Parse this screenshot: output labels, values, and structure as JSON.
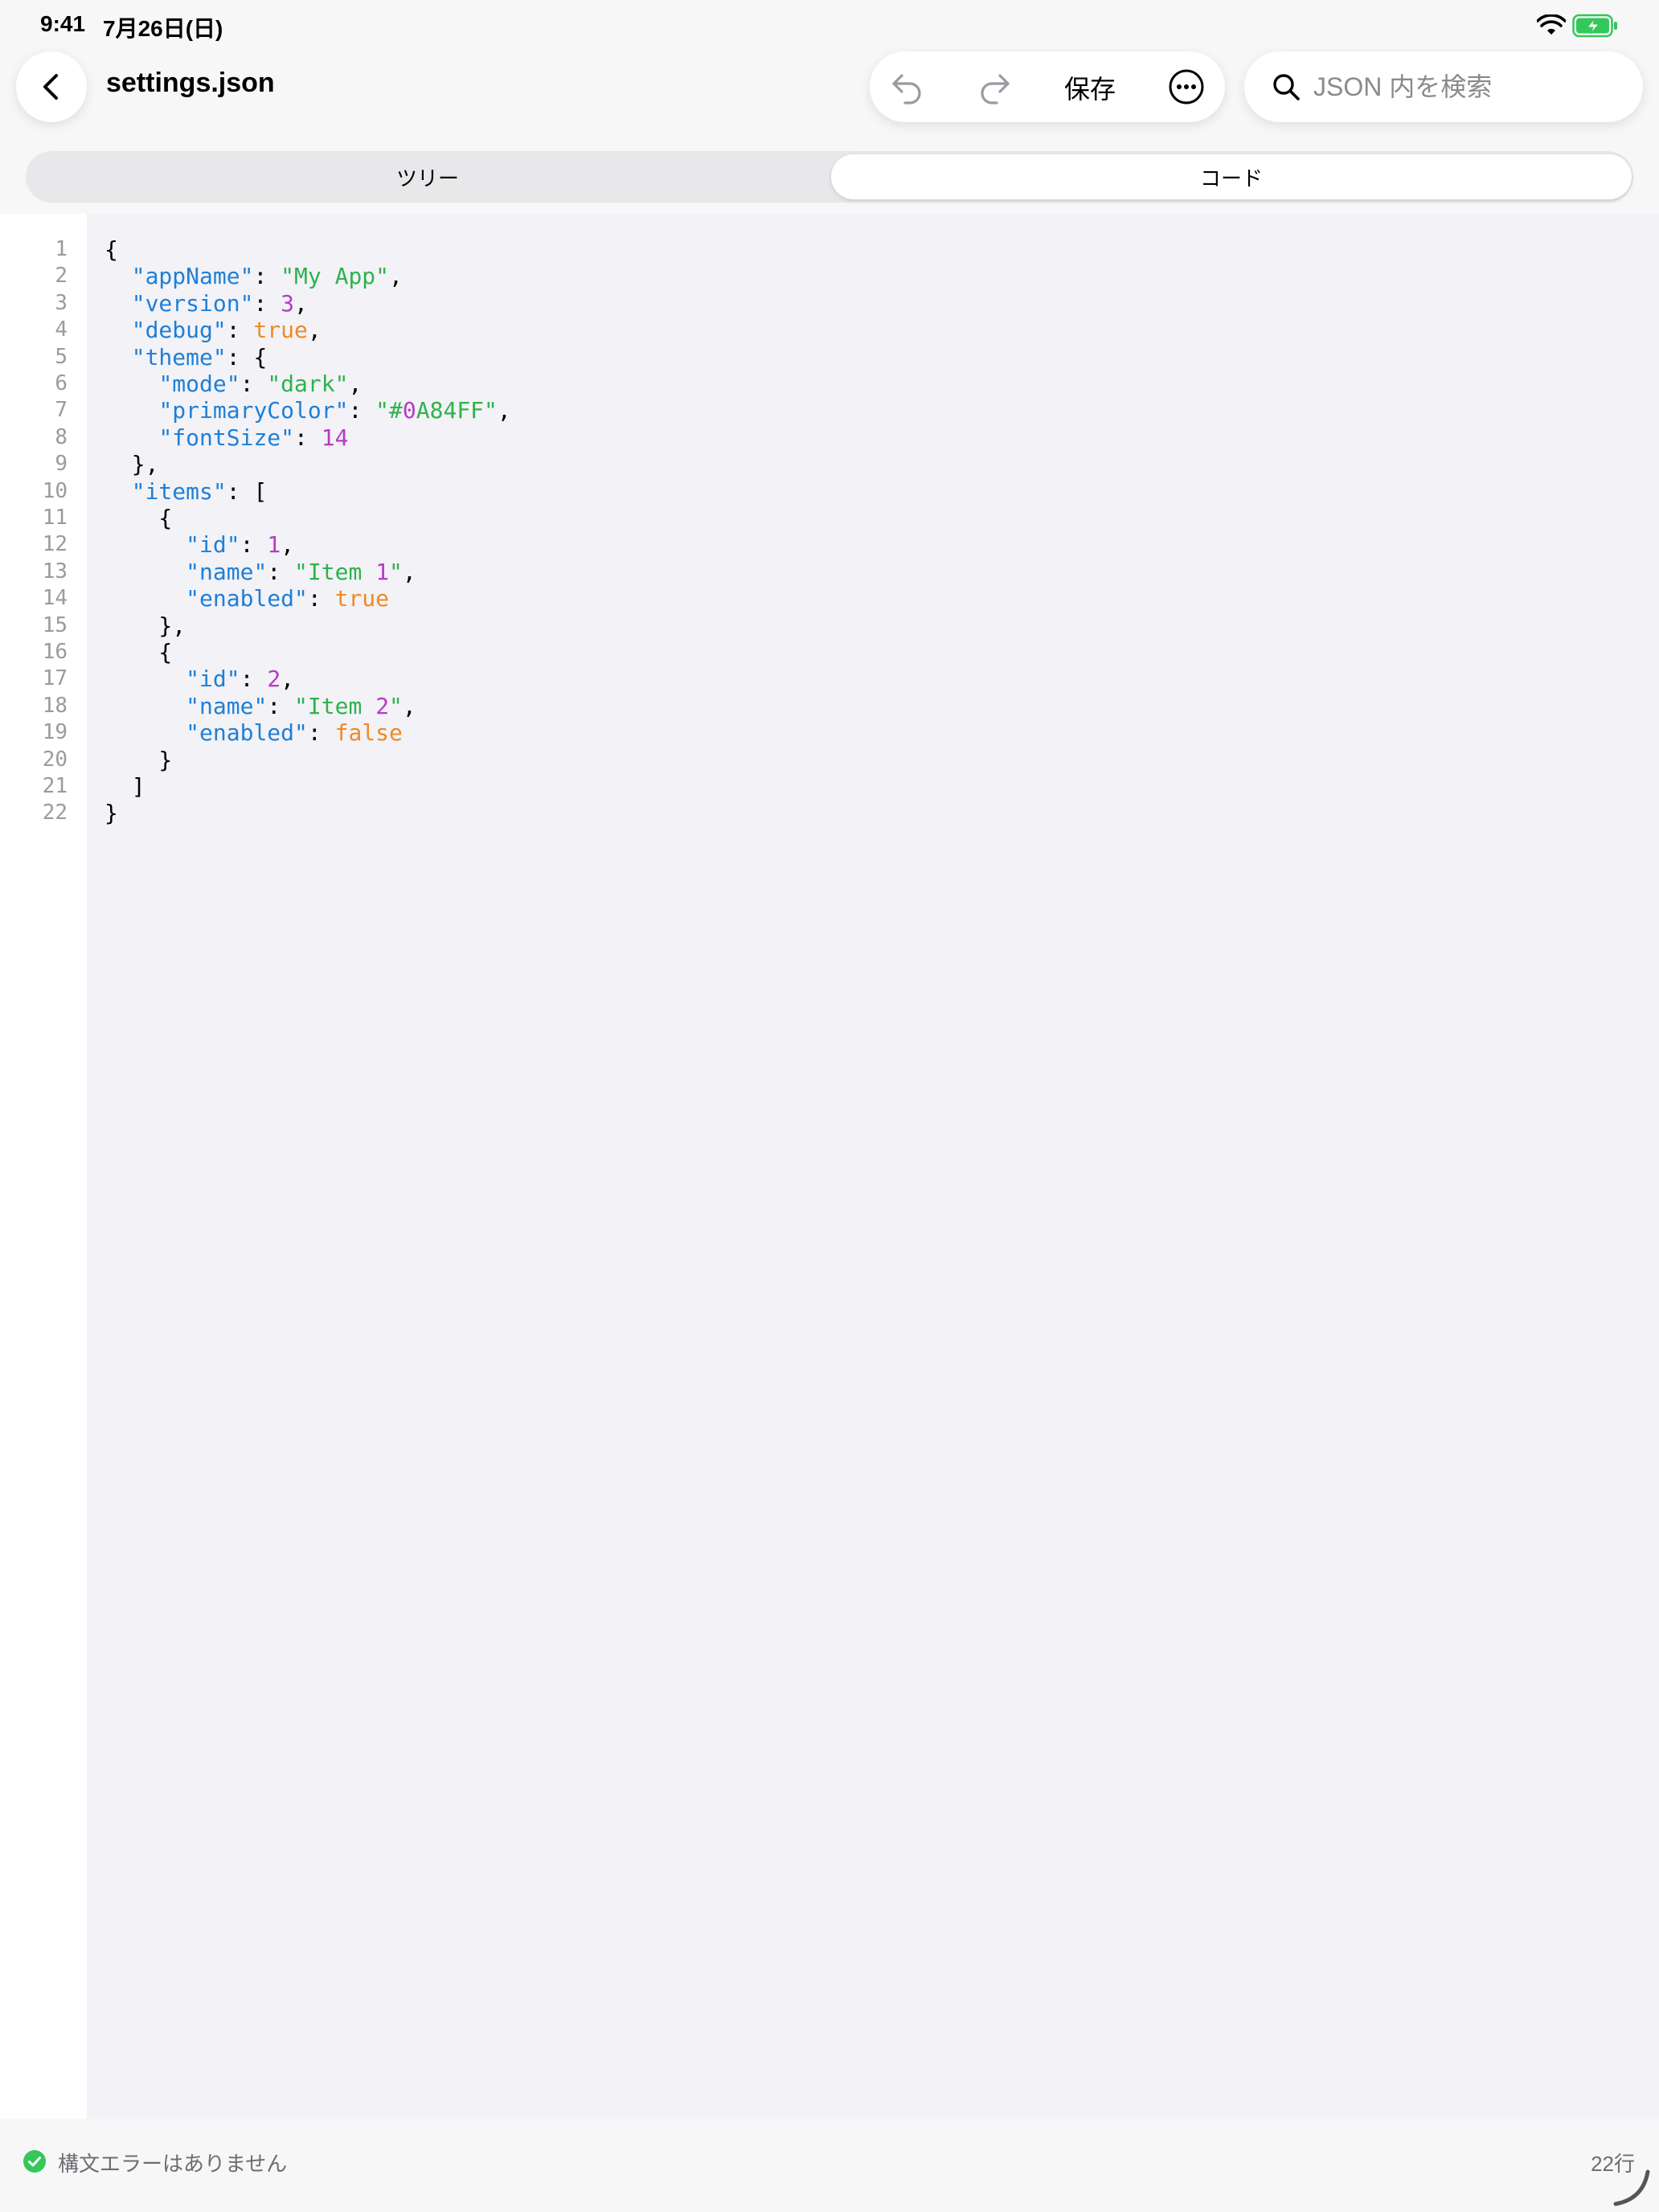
{
  "status_bar": {
    "time": "9:41",
    "date": "7月26日(日)"
  },
  "nav": {
    "title": "settings.json"
  },
  "toolbar": {
    "save_label": "保存"
  },
  "search": {
    "placeholder": "JSON 内を検索",
    "value": ""
  },
  "segmented": {
    "tabs": [
      "ツリー",
      "コード"
    ],
    "selected": "コード"
  },
  "editor": {
    "line_numbers": [
      "1",
      "2",
      "3",
      "4",
      "5",
      "6",
      "7",
      "8",
      "9",
      "10",
      "11",
      "12",
      "13",
      "14",
      "15",
      "16",
      "17",
      "18",
      "19",
      "20",
      "21",
      "22"
    ],
    "lines": [
      [
        {
          "t": "p",
          "v": "{"
        }
      ],
      [
        {
          "t": "p",
          "v": "  "
        },
        {
          "t": "k",
          "v": "\"appName\""
        },
        {
          "t": "p",
          "v": ": "
        },
        {
          "t": "s",
          "v": "\"My App\""
        },
        {
          "t": "p",
          "v": ","
        }
      ],
      [
        {
          "t": "p",
          "v": "  "
        },
        {
          "t": "k",
          "v": "\"version\""
        },
        {
          "t": "p",
          "v": ": "
        },
        {
          "t": "n",
          "v": "3"
        },
        {
          "t": "p",
          "v": ","
        }
      ],
      [
        {
          "t": "p",
          "v": "  "
        },
        {
          "t": "k",
          "v": "\"debug\""
        },
        {
          "t": "p",
          "v": ": "
        },
        {
          "t": "b",
          "v": "true"
        },
        {
          "t": "p",
          "v": ","
        }
      ],
      [
        {
          "t": "p",
          "v": "  "
        },
        {
          "t": "k",
          "v": "\"theme\""
        },
        {
          "t": "p",
          "v": ": {"
        }
      ],
      [
        {
          "t": "p",
          "v": "    "
        },
        {
          "t": "k",
          "v": "\"mode\""
        },
        {
          "t": "p",
          "v": ": "
        },
        {
          "t": "s",
          "v": "\"dark\""
        },
        {
          "t": "p",
          "v": ","
        }
      ],
      [
        {
          "t": "p",
          "v": "    "
        },
        {
          "t": "k",
          "v": "\"primaryColor\""
        },
        {
          "t": "p",
          "v": ": "
        },
        {
          "t": "s",
          "v": "\"#"
        },
        {
          "t": "n",
          "v": "0"
        },
        {
          "t": "s",
          "v": "A84FF\""
        },
        {
          "t": "p",
          "v": ","
        }
      ],
      [
        {
          "t": "p",
          "v": "    "
        },
        {
          "t": "k",
          "v": "\"fontSize\""
        },
        {
          "t": "p",
          "v": ": "
        },
        {
          "t": "n",
          "v": "14"
        }
      ],
      [
        {
          "t": "p",
          "v": "  },"
        }
      ],
      [
        {
          "t": "p",
          "v": "  "
        },
        {
          "t": "k",
          "v": "\"items\""
        },
        {
          "t": "p",
          "v": ": ["
        }
      ],
      [
        {
          "t": "p",
          "v": "    {"
        }
      ],
      [
        {
          "t": "p",
          "v": "      "
        },
        {
          "t": "k",
          "v": "\"id\""
        },
        {
          "t": "p",
          "v": ": "
        },
        {
          "t": "n",
          "v": "1"
        },
        {
          "t": "p",
          "v": ","
        }
      ],
      [
        {
          "t": "p",
          "v": "      "
        },
        {
          "t": "k",
          "v": "\"name\""
        },
        {
          "t": "p",
          "v": ": "
        },
        {
          "t": "s",
          "v": "\"Item "
        },
        {
          "t": "n",
          "v": "1"
        },
        {
          "t": "s",
          "v": "\""
        },
        {
          "t": "p",
          "v": ","
        }
      ],
      [
        {
          "t": "p",
          "v": "      "
        },
        {
          "t": "k",
          "v": "\"enabled\""
        },
        {
          "t": "p",
          "v": ": "
        },
        {
          "t": "b",
          "v": "true"
        }
      ],
      [
        {
          "t": "p",
          "v": "    },"
        }
      ],
      [
        {
          "t": "p",
          "v": "    {"
        }
      ],
      [
        {
          "t": "p",
          "v": "      "
        },
        {
          "t": "k",
          "v": "\"id\""
        },
        {
          "t": "p",
          "v": ": "
        },
        {
          "t": "n",
          "v": "2"
        },
        {
          "t": "p",
          "v": ","
        }
      ],
      [
        {
          "t": "p",
          "v": "      "
        },
        {
          "t": "k",
          "v": "\"name\""
        },
        {
          "t": "p",
          "v": ": "
        },
        {
          "t": "s",
          "v": "\"Item "
        },
        {
          "t": "n",
          "v": "2"
        },
        {
          "t": "s",
          "v": "\""
        },
        {
          "t": "p",
          "v": ","
        }
      ],
      [
        {
          "t": "p",
          "v": "      "
        },
        {
          "t": "k",
          "v": "\"enabled\""
        },
        {
          "t": "p",
          "v": ": "
        },
        {
          "t": "b",
          "v": "false"
        }
      ],
      [
        {
          "t": "p",
          "v": "    }"
        }
      ],
      [
        {
          "t": "p",
          "v": "  ]"
        }
      ],
      [
        {
          "t": "p",
          "v": "}"
        }
      ]
    ]
  },
  "footer": {
    "status": "構文エラーはありません",
    "line_count": "22行"
  },
  "icons": {
    "back": "chevron-left-icon",
    "undo": "undo-icon",
    "redo": "redo-icon",
    "more": "ellipsis-circle-icon",
    "search": "magnifier-icon",
    "ok": "checkmark-circle-icon",
    "resize": "resize-handle-icon",
    "wifi": "wifi-icon",
    "battery": "battery-charging-icon"
  },
  "colors": {
    "key": "#1f7fd6",
    "string": "#2fb24c",
    "number": "#b83ac6",
    "boolean": "#f08a24",
    "ok": "#34c759",
    "battery": "#34c759"
  }
}
